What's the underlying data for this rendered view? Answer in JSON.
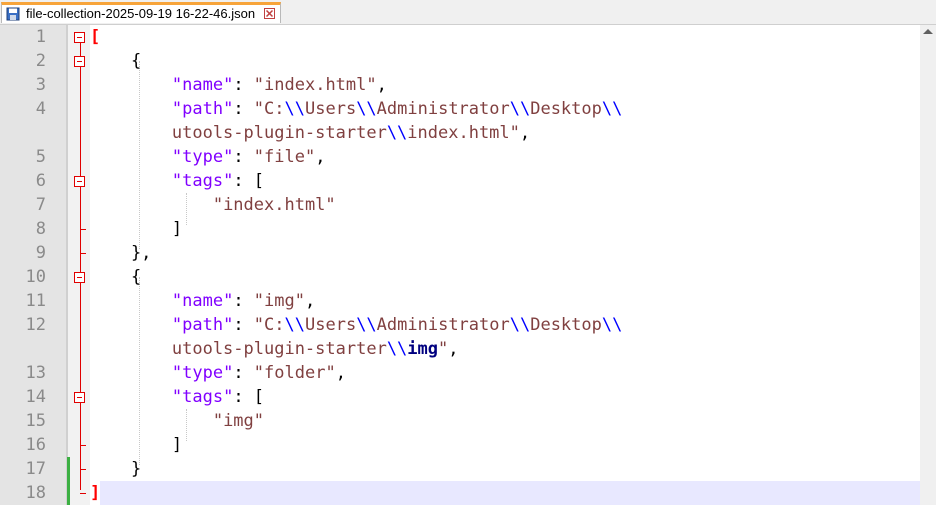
{
  "tab": {
    "title": "file-collection-2025-09-19 16-22-46.json",
    "icon": "save-disk-icon",
    "close_icon": "close-icon"
  },
  "editor": {
    "line_numbers": [
      "1",
      "2",
      "3",
      "4",
      "",
      "5",
      "6",
      "7",
      "8",
      "9",
      "10",
      "11",
      "12",
      "",
      "13",
      "14",
      "15",
      "16",
      "17",
      "18"
    ],
    "lines": [
      [
        [
          "red",
          "["
        ]
      ],
      [
        [
          "p",
          "    {"
        ]
      ],
      [
        [
          "p",
          "        "
        ],
        [
          "k",
          "\"name\""
        ],
        [
          "p",
          ": "
        ],
        [
          "s",
          "\"index.html\""
        ],
        [
          "p",
          ","
        ]
      ],
      [
        [
          "p",
          "        "
        ],
        [
          "k",
          "\"path\""
        ],
        [
          "p",
          ": "
        ],
        [
          "s",
          "\"C:"
        ],
        [
          "esc",
          "\\\\"
        ],
        [
          "s",
          "Users"
        ],
        [
          "esc",
          "\\\\"
        ],
        [
          "s",
          "Administrator"
        ],
        [
          "esc",
          "\\\\"
        ],
        [
          "s",
          "Desktop"
        ],
        [
          "esc",
          "\\\\"
        ]
      ],
      [
        [
          "s",
          "        utools-plugin-starter"
        ],
        [
          "esc",
          "\\\\"
        ],
        [
          "s",
          "index.html\""
        ],
        [
          "p",
          ","
        ]
      ],
      [
        [
          "p",
          "        "
        ],
        [
          "k",
          "\"type\""
        ],
        [
          "p",
          ": "
        ],
        [
          "s",
          "\"file\""
        ],
        [
          "p",
          ","
        ]
      ],
      [
        [
          "p",
          "        "
        ],
        [
          "k",
          "\"tags\""
        ],
        [
          "p",
          ": ["
        ]
      ],
      [
        [
          "p",
          "            "
        ],
        [
          "s",
          "\"index.html\""
        ]
      ],
      [
        [
          "p",
          "        ]"
        ]
      ],
      [
        [
          "p",
          "    },"
        ]
      ],
      [
        [
          "p",
          "    {"
        ]
      ],
      [
        [
          "p",
          "        "
        ],
        [
          "k",
          "\"name\""
        ],
        [
          "p",
          ": "
        ],
        [
          "s",
          "\"img\""
        ],
        [
          "p",
          ","
        ]
      ],
      [
        [
          "p",
          "        "
        ],
        [
          "k",
          "\"path\""
        ],
        [
          "p",
          ": "
        ],
        [
          "s",
          "\"C:"
        ],
        [
          "esc",
          "\\\\"
        ],
        [
          "s",
          "Users"
        ],
        [
          "esc",
          "\\\\"
        ],
        [
          "s",
          "Administrator"
        ],
        [
          "esc",
          "\\\\"
        ],
        [
          "s",
          "Desktop"
        ],
        [
          "esc",
          "\\\\"
        ]
      ],
      [
        [
          "s",
          "        utools-plugin-starter"
        ],
        [
          "esc",
          "\\\\"
        ],
        [
          "escb",
          "img"
        ],
        [
          "s",
          "\""
        ],
        [
          "p",
          ","
        ]
      ],
      [
        [
          "p",
          "        "
        ],
        [
          "k",
          "\"type\""
        ],
        [
          "p",
          ": "
        ],
        [
          "s",
          "\"folder\""
        ],
        [
          "p",
          ","
        ]
      ],
      [
        [
          "p",
          "        "
        ],
        [
          "k",
          "\"tags\""
        ],
        [
          "p",
          ": ["
        ]
      ],
      [
        [
          "p",
          "            "
        ],
        [
          "s",
          "\"img\""
        ]
      ],
      [
        [
          "p",
          "        ]"
        ]
      ],
      [
        [
          "p",
          "    }"
        ]
      ],
      [
        [
          "red",
          "]"
        ]
      ]
    ]
  },
  "colors": {
    "key": "#8000ff",
    "string": "#804040",
    "escape": "#0000ff",
    "bracket_match": "#ff0000",
    "fold_marker": "#e00000",
    "changed_line": "#3cb043",
    "current_line_bg": "#e8e8ff",
    "tab_accent": "#f7a43a"
  }
}
